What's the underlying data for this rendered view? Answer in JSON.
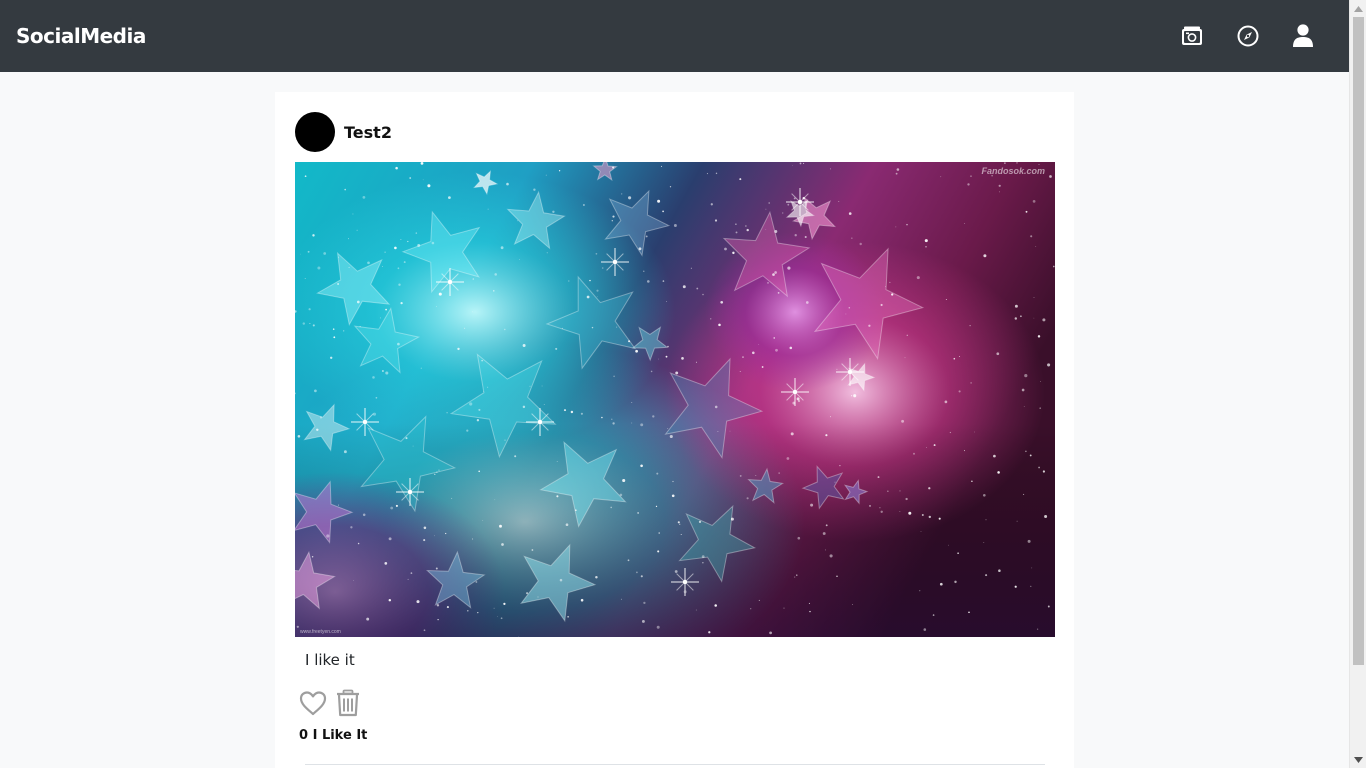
{
  "navbar": {
    "brand": "SocialMedia",
    "icons": [
      "upload-photo-icon",
      "explore-compass-icon",
      "profile-user-icon"
    ]
  },
  "post": {
    "username": "Test2",
    "image": {
      "watermark_top": "Fandosok.com",
      "watermark_bottom": "www.freetyen.com"
    },
    "caption": "I like it",
    "like_count": "0",
    "like_label": "I Like It"
  },
  "colors": {
    "navbar_bg": "#343a40",
    "page_bg": "#f8f9fa",
    "card_bg": "#ffffff",
    "icon_gray": "#9e9e9e"
  }
}
